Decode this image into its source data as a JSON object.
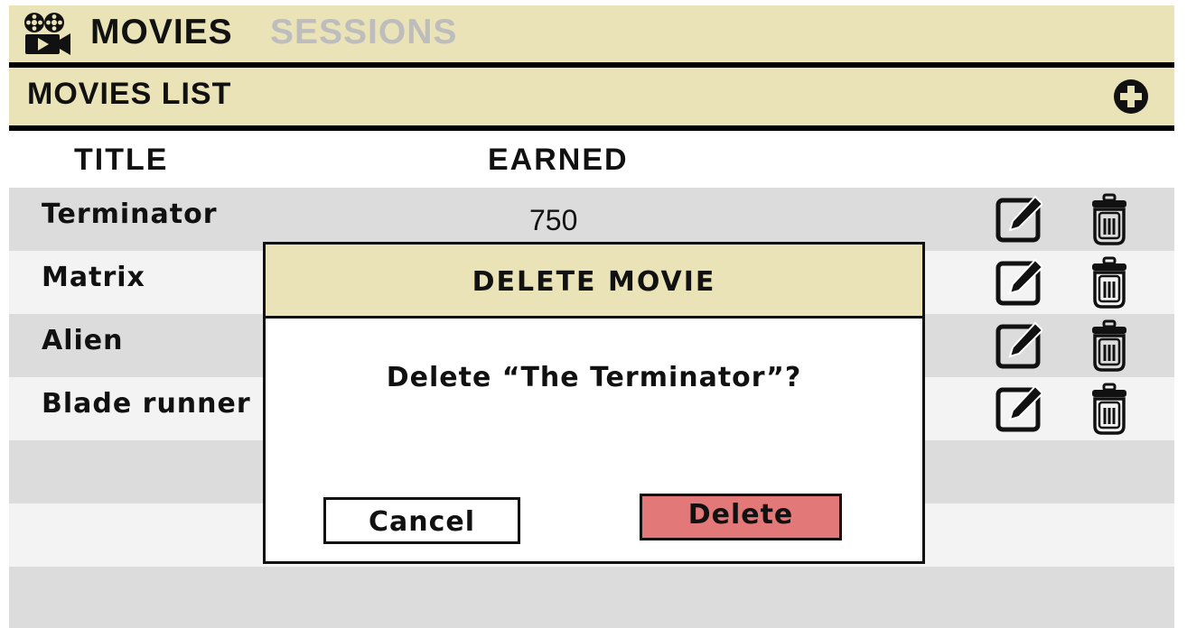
{
  "nav": {
    "logo_icon": "film-camera-icon",
    "tabs": [
      {
        "label": "MOVIES",
        "active": true
      },
      {
        "label": "SESSIONS",
        "active": false
      }
    ]
  },
  "section": {
    "title": "MOVIES LIST",
    "add_icon": "plus-circle-icon"
  },
  "table": {
    "columns": [
      "TITLE",
      "EARNED"
    ],
    "rows": [
      {
        "title": "Terminator",
        "earned": "750"
      },
      {
        "title": "Matrix",
        "earned": ""
      },
      {
        "title": "Alien",
        "earned": ""
      },
      {
        "title": "Blade runner",
        "earned": ""
      }
    ],
    "row_actions": [
      "edit-icon",
      "trash-icon"
    ]
  },
  "modal": {
    "title": "DELETE MOVIE",
    "message": "Delete “The Terminator”?",
    "cancel_label": "Cancel",
    "delete_label": "Delete"
  },
  "colors": {
    "header_bg": "#e9e3b7",
    "row_dark": "#dcdcdc",
    "row_light": "#f3f3f3",
    "delete_button": "#e37878",
    "inactive_tab": "#bdbdbd"
  }
}
